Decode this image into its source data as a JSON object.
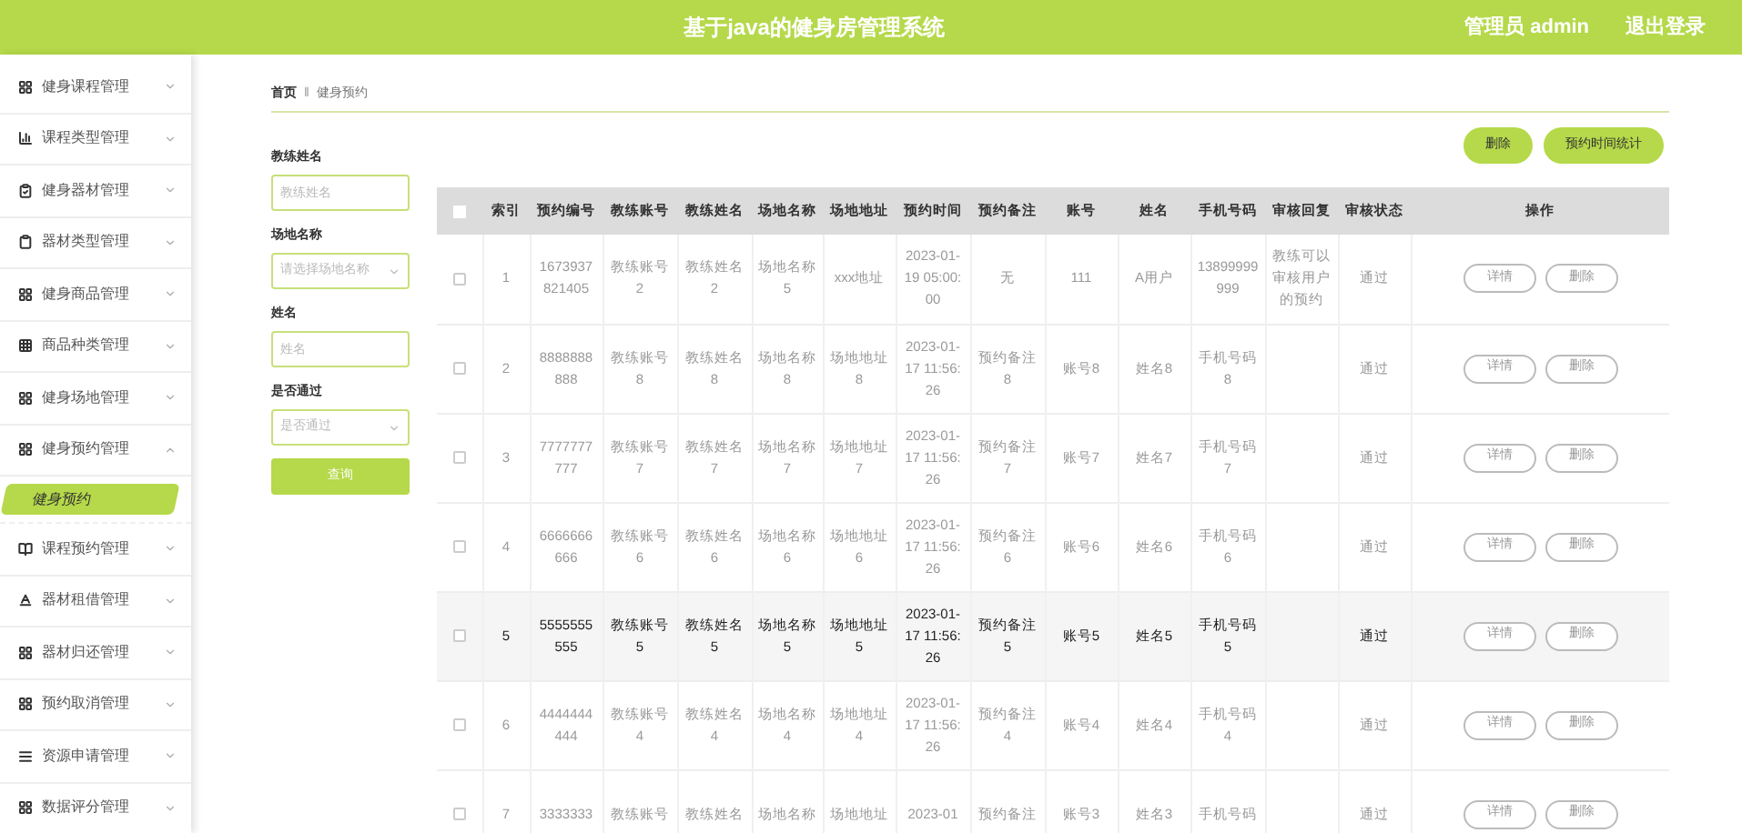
{
  "header": {
    "title": "基于java的健身房管理系统",
    "user": "管理员 admin",
    "logout": "退出登录"
  },
  "sidebar": {
    "items": [
      {
        "label": "健身课程管理",
        "expanded": false
      },
      {
        "label": "课程类型管理",
        "expanded": false
      },
      {
        "label": "健身器材管理",
        "expanded": false
      },
      {
        "label": "器材类型管理",
        "expanded": false
      },
      {
        "label": "健身商品管理",
        "expanded": false
      },
      {
        "label": "商品种类管理",
        "expanded": false
      },
      {
        "label": "健身场地管理",
        "expanded": false
      },
      {
        "label": "健身预约管理",
        "expanded": true,
        "children": [
          {
            "label": "健身预约",
            "selected": true
          }
        ]
      },
      {
        "label": "课程预约管理",
        "expanded": false
      },
      {
        "label": "器材租借管理",
        "expanded": false
      },
      {
        "label": "器材归还管理",
        "expanded": false
      },
      {
        "label": "预约取消管理",
        "expanded": false
      },
      {
        "label": "资源申请管理",
        "expanded": false
      },
      {
        "label": "数据评分管理",
        "expanded": false
      }
    ]
  },
  "breadcrumb": {
    "home": "首页",
    "separator": "ǁ",
    "current": "健身预约"
  },
  "filters": [
    {
      "kind": "input",
      "label": "教练姓名",
      "placeholder": "教练姓名"
    },
    {
      "kind": "select",
      "label": "场地名称",
      "placeholder": "请选择场地名称"
    },
    {
      "kind": "input",
      "label": "姓名",
      "placeholder": "姓名"
    },
    {
      "kind": "select",
      "label": "是否通过",
      "placeholder": "是否通过"
    }
  ],
  "search_button": "查询",
  "actions": [
    "删除",
    "预约时间统计"
  ],
  "table": {
    "select_all_checked": false,
    "columns": [
      "索引",
      "预约编号",
      "教练账号",
      "教练姓名",
      "场地名称",
      "场地地址",
      "预约时间",
      "预约备注",
      "账号",
      "姓名",
      "手机号码",
      "审核回复",
      "审核状态",
      "操作"
    ],
    "rows": [
      {
        "highlighted": false,
        "checked": false,
        "cells": [
          "1",
          "1673937821405",
          "教练账号2",
          "教练姓名2",
          "场地名称5",
          "xxx地址",
          "2023-01-19 05:00:00",
          "无",
          "111",
          "A用户",
          "13899999999",
          "教练可以审核用户的预约",
          "通过"
        ],
        "buttons": [
          "详情",
          "删除"
        ]
      },
      {
        "highlighted": false,
        "checked": false,
        "cells": [
          "2",
          "8888888888",
          "教练账号8",
          "教练姓名8",
          "场地名称8",
          "场地地址8",
          "2023-01-17 11:56:26",
          "预约备注8",
          "账号8",
          "姓名8",
          "手机号码8",
          "",
          "通过"
        ],
        "buttons": [
          "详情",
          "删除"
        ]
      },
      {
        "highlighted": false,
        "checked": false,
        "cells": [
          "3",
          "7777777777",
          "教练账号7",
          "教练姓名7",
          "场地名称7",
          "场地地址7",
          "2023-01-17 11:56:26",
          "预约备注7",
          "账号7",
          "姓名7",
          "手机号码7",
          "",
          "通过"
        ],
        "buttons": [
          "详情",
          "删除"
        ]
      },
      {
        "highlighted": false,
        "checked": false,
        "cells": [
          "4",
          "6666666666",
          "教练账号6",
          "教练姓名6",
          "场地名称6",
          "场地地址6",
          "2023-01-17 11:56:26",
          "预约备注6",
          "账号6",
          "姓名6",
          "手机号码6",
          "",
          "通过"
        ],
        "buttons": [
          "详情",
          "删除"
        ]
      },
      {
        "highlighted": true,
        "checked": false,
        "cells": [
          "5",
          "5555555555",
          "教练账号5",
          "教练姓名5",
          "场地名称5",
          "场地地址5",
          "2023-01-17 11:56:26",
          "预约备注5",
          "账号5",
          "姓名5",
          "手机号码5",
          "",
          "通过"
        ],
        "buttons": [
          "详情",
          "删除"
        ]
      },
      {
        "highlighted": false,
        "checked": false,
        "cells": [
          "6",
          "4444444444",
          "教练账号4",
          "教练姓名4",
          "场地名称4",
          "场地地址4",
          "2023-01-17 11:56:26",
          "预约备注4",
          "账号4",
          "姓名4",
          "手机号码4",
          "",
          "通过"
        ],
        "buttons": [
          "详情",
          "删除"
        ]
      },
      {
        "highlighted": false,
        "checked": false,
        "cells": [
          "7",
          "3333333",
          "教练账号",
          "教练姓名",
          "场地名称",
          "场地地址",
          "2023-01",
          "预约备注",
          "账号3",
          "姓名3",
          "手机号码",
          "",
          "通过"
        ],
        "buttons": [
          "详情",
          "删除"
        ]
      }
    ]
  }
}
